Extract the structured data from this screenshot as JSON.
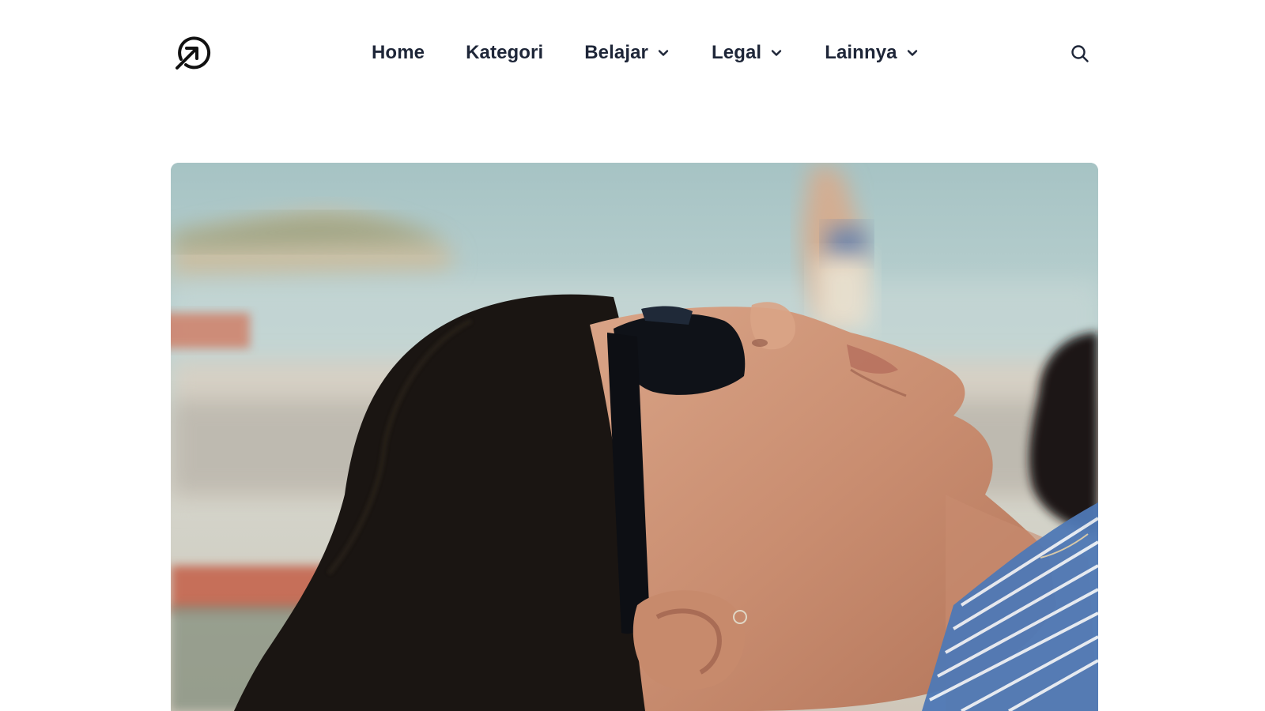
{
  "header": {
    "logo_icon": "arrow-up-right-circle-icon",
    "nav": [
      {
        "label": "Home",
        "has_dropdown": false
      },
      {
        "label": "Kategori",
        "has_dropdown": false
      },
      {
        "label": "Belajar",
        "has_dropdown": true
      },
      {
        "label": "Legal",
        "has_dropdown": true
      },
      {
        "label": "Lainnya",
        "has_dropdown": true
      }
    ],
    "search_icon": "search-icon"
  },
  "hero": {
    "image_subject": "woman-in-sunglasses-on-beach"
  },
  "colors": {
    "text": "#1e2638",
    "background": "#ffffff"
  }
}
